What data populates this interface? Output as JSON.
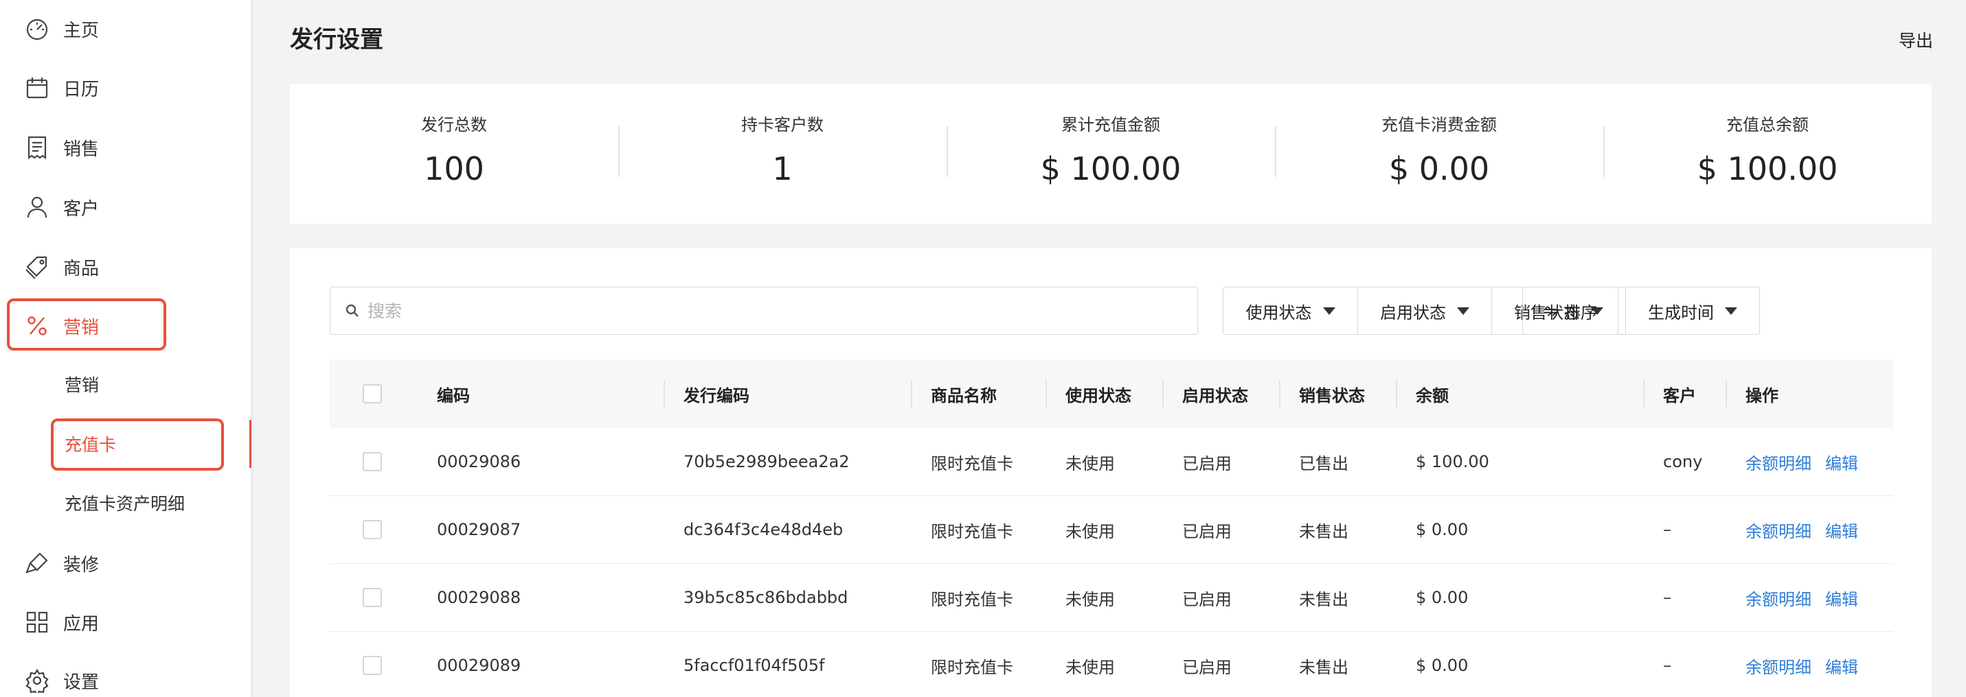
{
  "sidebar": {
    "items": [
      {
        "label": "主页",
        "icon": "dashboard-icon"
      },
      {
        "label": "日历",
        "icon": "calendar-icon"
      },
      {
        "label": "销售",
        "icon": "receipt-icon"
      },
      {
        "label": "客户",
        "icon": "user-icon"
      },
      {
        "label": "商品",
        "icon": "tag-icon"
      },
      {
        "label": "营销",
        "icon": "percent-icon"
      },
      {
        "label": "装修",
        "icon": "brush-icon"
      },
      {
        "label": "应用",
        "icon": "apps-icon"
      },
      {
        "label": "设置",
        "icon": "gear-icon"
      }
    ],
    "sub_items": [
      {
        "label": "营销"
      },
      {
        "label": "充值卡"
      },
      {
        "label": "充值卡资产明细"
      }
    ],
    "accent_color": "#e8503a"
  },
  "header": {
    "title": "发行设置",
    "export_label": "导出"
  },
  "stats": [
    {
      "label": "发行总数",
      "value": "100"
    },
    {
      "label": "持卡客户数",
      "value": "1"
    },
    {
      "label": "累计充值金额",
      "value": "$ 100.00"
    },
    {
      "label": "充值卡消费金额",
      "value": "$ 0.00"
    },
    {
      "label": "充值总余额",
      "value": "$ 100.00"
    }
  ],
  "toolbar": {
    "search_placeholder": "搜索",
    "filters": [
      "使用状态",
      "启用状态",
      "销售状态",
      "生成时间"
    ],
    "sort_label": "排序"
  },
  "table": {
    "headers": [
      "编码",
      "发行编码",
      "商品名称",
      "使用状态",
      "启用状态",
      "销售状态",
      "余额",
      "客户",
      "操作"
    ],
    "rows": [
      {
        "code": "00029086",
        "issue_code": "70b5e2989beea2a2",
        "product": "限时充值卡",
        "use_status": "未使用",
        "enable_status": "已启用",
        "sale_status": "已售出",
        "balance": "$ 100.00",
        "customer": "cony",
        "action_detail": "余额明细",
        "action_edit": "编辑"
      },
      {
        "code": "00029087",
        "issue_code": "dc364f3c4e48d4eb",
        "product": "限时充值卡",
        "use_status": "未使用",
        "enable_status": "已启用",
        "sale_status": "未售出",
        "balance": "$ 0.00",
        "customer": "–",
        "action_detail": "余额明细",
        "action_edit": "编辑"
      },
      {
        "code": "00029088",
        "issue_code": "39b5c85c86bdabbd",
        "product": "限时充值卡",
        "use_status": "未使用",
        "enable_status": "已启用",
        "sale_status": "未售出",
        "balance": "$ 0.00",
        "customer": "–",
        "action_detail": "余额明细",
        "action_edit": "编辑"
      },
      {
        "code": "00029089",
        "issue_code": "5faccf01f04f505f",
        "product": "限时充值卡",
        "use_status": "未使用",
        "enable_status": "已启用",
        "sale_status": "未售出",
        "balance": "$ 0.00",
        "customer": "–",
        "action_detail": "余额明细",
        "action_edit": "编辑"
      }
    ],
    "link_color": "#2f7ed8"
  }
}
